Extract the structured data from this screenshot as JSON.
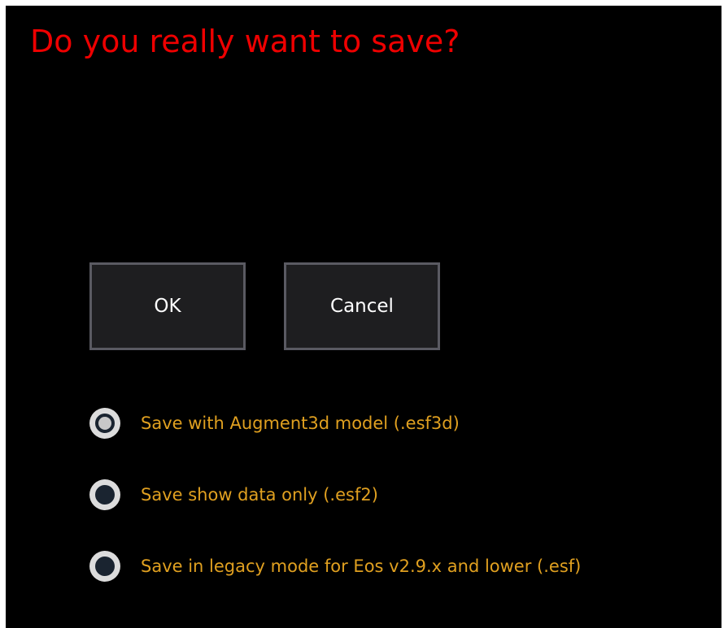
{
  "dialog": {
    "title": "Do you really want to save?",
    "ok_label": "OK",
    "cancel_label": "Cancel",
    "options": [
      {
        "label": "Save with Augment3d model (.esf3d)",
        "selected": true
      },
      {
        "label": "Save show data only (.esf2)",
        "selected": false
      },
      {
        "label": "Save in legacy mode for Eos v2.9.x and lower (.esf)",
        "selected": false
      }
    ]
  },
  "colors": {
    "background": "#000000",
    "title": "#ee0000",
    "option_text": "#e0a020",
    "button_bg": "#1e1e20",
    "button_border": "#5a5a62"
  }
}
